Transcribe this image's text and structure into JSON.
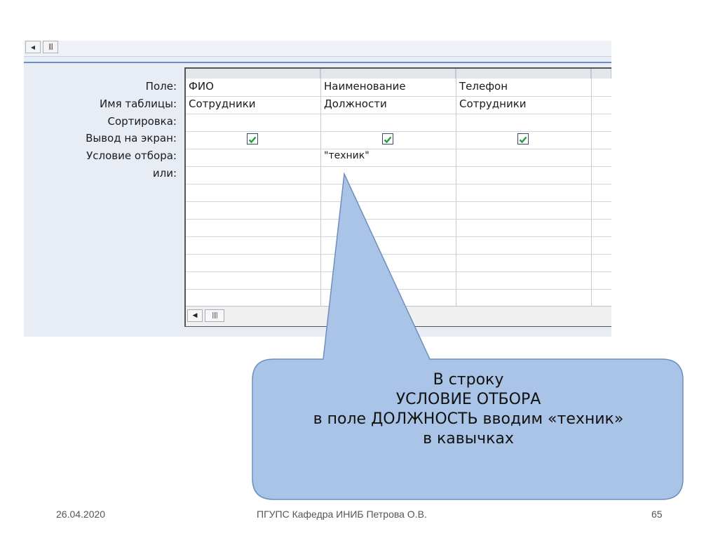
{
  "query_grid": {
    "row_labels": [
      "Поле:",
      "Имя таблицы:",
      "Сортировка:",
      "Вывод на экран:",
      "Условие отбора:",
      "или:"
    ],
    "columns": [
      {
        "field": "ФИО",
        "table": "Сотрудники",
        "show": true,
        "criteria": ""
      },
      {
        "field": "Наименование",
        "table": "Должности",
        "show": true,
        "criteria": "\"техник\""
      },
      {
        "field": "Телефон",
        "table": "Сотрудники",
        "show": true,
        "criteria": ""
      }
    ]
  },
  "callout": {
    "lines": [
      "В строку",
      "УСЛОВИЕ ОТБОРА",
      "в поле ДОЛЖНОСТЬ вводим «техник»",
      "в кавычках"
    ]
  },
  "footer": {
    "date": "26.04.2020",
    "center": "ПГУПС  Кафедра  ИНИБ  Петрова О.В.",
    "page": "65"
  },
  "colors": {
    "callout_fill": "#a9c4e6",
    "callout_stroke": "#6e8fbd",
    "check": "#1f9e3a",
    "panel_bg": "#e8edf5"
  }
}
